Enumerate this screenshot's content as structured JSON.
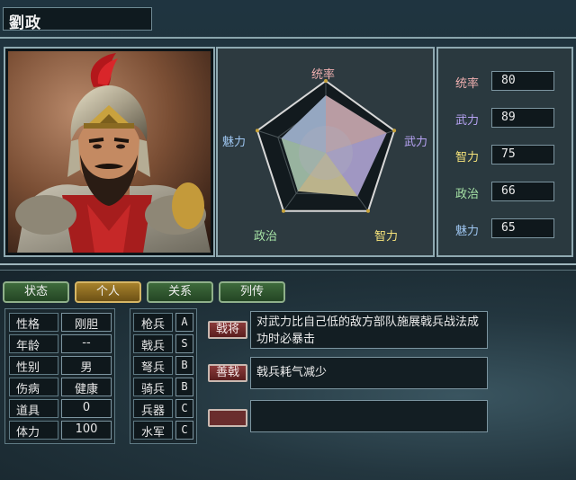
{
  "officer": {
    "name": "劉政"
  },
  "radar": {
    "labels": [
      "统率",
      "武力",
      "智力",
      "政治",
      "魅力"
    ],
    "label_colors": [
      "#f0b0b0",
      "#b8a4f5",
      "#f5e37a",
      "#a6e3a6",
      "#9fc7f2"
    ],
    "values": [
      80,
      89,
      75,
      66,
      65
    ]
  },
  "stats": [
    {
      "label": "统率",
      "value": "80",
      "color": "#f0b0b0"
    },
    {
      "label": "武力",
      "value": "89",
      "color": "#b8a4f5"
    },
    {
      "label": "智力",
      "value": "75",
      "color": "#f5e37a"
    },
    {
      "label": "政治",
      "value": "66",
      "color": "#a6e3a6"
    },
    {
      "label": "魅力",
      "value": "65",
      "color": "#9fc7f2"
    }
  ],
  "tabs": [
    {
      "label": "状态",
      "active": false
    },
    {
      "label": "个人",
      "active": true
    },
    {
      "label": "关系",
      "active": false
    },
    {
      "label": "列传",
      "active": false
    }
  ],
  "attributes": [
    {
      "label": "性格",
      "value": "刚胆"
    },
    {
      "label": "年龄",
      "value": "--"
    },
    {
      "label": "性别",
      "value": "男"
    },
    {
      "label": "伤病",
      "value": "健康"
    },
    {
      "label": "道具",
      "value": "0"
    },
    {
      "label": "体力",
      "value": "100"
    }
  ],
  "troops": [
    {
      "label": "枪兵",
      "value": "A"
    },
    {
      "label": "戟兵",
      "value": "S"
    },
    {
      "label": "弩兵",
      "value": "B"
    },
    {
      "label": "骑兵",
      "value": "B"
    },
    {
      "label": "兵器",
      "value": "C"
    },
    {
      "label": "水军",
      "value": "C"
    }
  ],
  "skills": [
    {
      "name": "戟将",
      "description": "对武力比自己低的敌方部队施展戟兵战法成功时必暴击"
    },
    {
      "name": "善戟",
      "description": "戟兵耗气减少"
    },
    {
      "name": "",
      "description": ""
    }
  ],
  "icons": {
    "portrait": "general-portrait-illustration"
  }
}
